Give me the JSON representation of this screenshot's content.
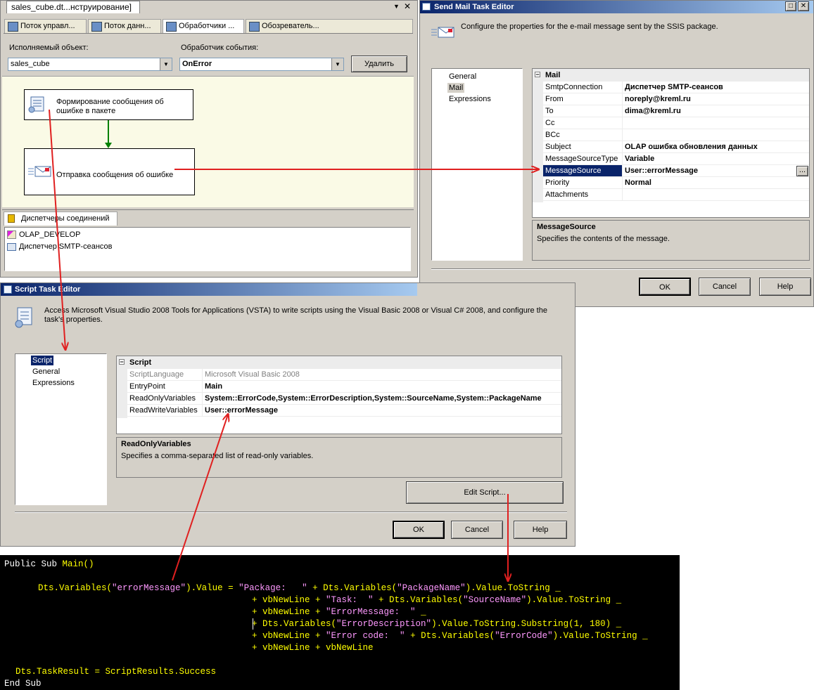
{
  "designer": {
    "doc_tab": "sales_cube.dt...нструирование]",
    "tabs": [
      "Поток управл...",
      "Поток данн...",
      "Обработчики ...",
      "Обозреватель..."
    ],
    "executable_label": "Исполняемый объект:",
    "executable_value": "sales_cube",
    "event_label": "Обработчик события:",
    "event_value": "OnError",
    "delete_button": "Удалить",
    "task1": "Формирование сообщения об ошибке в пакете",
    "task2": "Отправка сообщения об ошибке",
    "conn_tab": "Диспетчеры соединений",
    "connections": [
      "OLAP_DEVELOP",
      "Диспетчер SMTP-сеансов"
    ]
  },
  "mail": {
    "title": "Send Mail Task Editor",
    "description": "Configure the properties for the e-mail message sent by the SSIS package.",
    "nav": [
      "General",
      "Mail",
      "Expressions"
    ],
    "section": "Mail",
    "props": [
      {
        "name": "SmtpConnection",
        "value": "Диспетчер SMTP-сеансов"
      },
      {
        "name": "From",
        "value": "noreply@kreml.ru"
      },
      {
        "name": "To",
        "value": "dima@kreml.ru"
      },
      {
        "name": "Cc",
        "value": ""
      },
      {
        "name": "BCc",
        "value": ""
      },
      {
        "name": "Subject",
        "value": "OLAP ошибка обновления данных"
      },
      {
        "name": "MessageSourceType",
        "value": "Variable"
      },
      {
        "name": "MessageSource",
        "value": "User::errorMessage"
      },
      {
        "name": "Priority",
        "value": "Normal"
      },
      {
        "name": "Attachments",
        "value": ""
      }
    ],
    "ellipsis": "...",
    "help_title": "MessageSource",
    "help_text": "Specifies the contents of the message.",
    "ok": "OK",
    "cancel": "Cancel",
    "help": "Help"
  },
  "script": {
    "title": "Script Task Editor",
    "description": "Access Microsoft Visual Studio 2008 Tools for Applications (VSTA) to write scripts using the Visual Basic 2008 or Visual C# 2008, and configure the task's properties.",
    "nav": [
      "Script",
      "General",
      "Expressions"
    ],
    "section": "Script",
    "props": [
      {
        "name": "ScriptLanguage",
        "value": "Microsoft Visual Basic 2008"
      },
      {
        "name": "EntryPoint",
        "value": "Main"
      },
      {
        "name": "ReadOnlyVariables",
        "value": "System::ErrorCode,System::ErrorDescription,System::SourceName,System::PackageName"
      },
      {
        "name": "ReadWriteVariables",
        "value": "User::errorMessage"
      }
    ],
    "help_title": "ReadOnlyVariables",
    "help_text": "Specifies a comma-separated list of read-only variables.",
    "edit_script": "Edit Script...",
    "ok": "OK",
    "cancel": "Cancel",
    "help": "Help"
  },
  "code": {
    "l1": "Public Sub ",
    "l1b": "Main()",
    "l2a": "Dts.Variables(",
    "l2b": "\"errorMessage\"",
    "l2c": ").Value = ",
    "l2d": "\"Package:   \"",
    "l2e": " + Dts.Variables(",
    "l2f": "\"PackageName\"",
    "l2g": ").Value.ToString _",
    "l3a": "+ vbNewLine + ",
    "l3b": "\"Task:  \"",
    "l3c": " + Dts.Variables(",
    "l3d": "\"SourceName\"",
    "l3e": ").Value.ToString _",
    "l4a": "+ vbNewLine + ",
    "l4b": "\"ErrorMessage:  \"",
    "l4c": " _",
    "l5a": "+ Dts.Variables(",
    "l5b": "\"ErrorDescription\"",
    "l5c": ").Value.ToString.Substring(1, 180) _",
    "l6a": "+ vbNewLine + ",
    "l6b": "\"Error code:  \"",
    "l6c": " + Dts.Variables(",
    "l6d": "\"ErrorCode\"",
    "l6e": ").Value.ToString _",
    "l7": "+ vbNewLine + vbNewLine",
    "l8": "Dts.TaskResult = ScriptResults.Success",
    "l9": "End Sub"
  },
  "colors": {
    "annotation_arrow": "#e02020",
    "title_active": "#0a246a",
    "code_keyword": "#ffff00",
    "code_string": "#ff99ff"
  }
}
